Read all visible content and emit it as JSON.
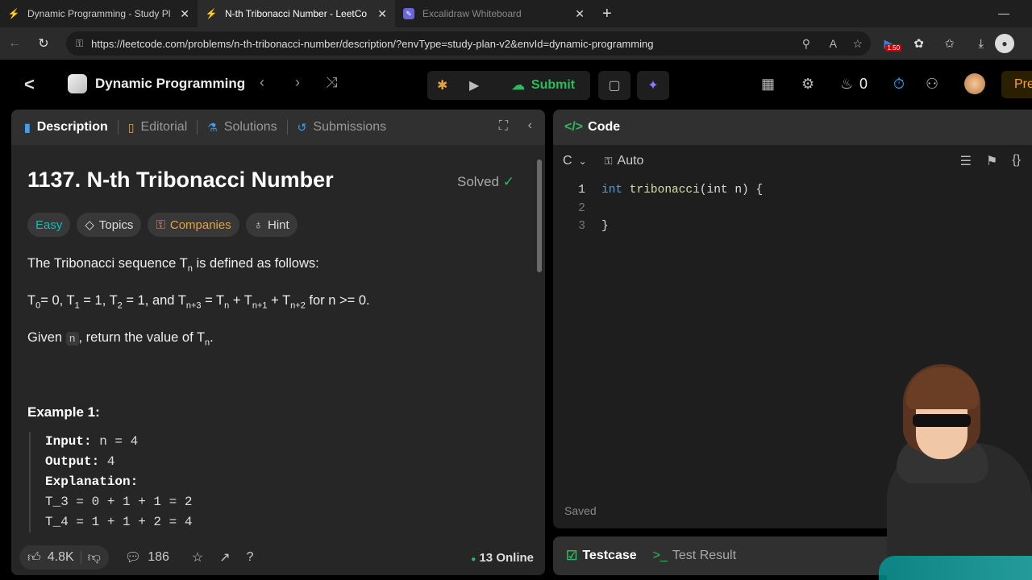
{
  "browser": {
    "tabs": [
      {
        "title": "Dynamic Programming - Study Pl",
        "active": false
      },
      {
        "title": "N-th Tribonacci Number - LeetCo",
        "active": true
      },
      {
        "title": "Excalidraw Whiteboard",
        "active": false
      }
    ],
    "url": "https://leetcode.com/problems/n-th-tribonacci-number/description/?envType=study-plan-v2&envId=dynamic-programming",
    "ext_badge": "1.50"
  },
  "nav": {
    "study_plan": "Dynamic Programming",
    "submit_label": "Submit",
    "streak": "0",
    "premium_label": "Pre"
  },
  "left": {
    "tabs": [
      {
        "label": "Description",
        "icon": "doc-icon"
      },
      {
        "label": "Editorial",
        "icon": "book-icon"
      },
      {
        "label": "Solutions",
        "icon": "flask-icon"
      },
      {
        "label": "Submissions",
        "icon": "history-icon"
      }
    ],
    "title": "1137. N-th Tribonacci Number",
    "status": "Solved",
    "chips": {
      "difficulty": "Easy",
      "topics": "Topics",
      "companies": "Companies",
      "hint": "Hint"
    },
    "intro": "The Tribonacci sequence T",
    "intro_sub": "n",
    "intro_end": " is defined as follows:",
    "def": {
      "t0": "T",
      "t0s": "0",
      "t0v": "= 0, ",
      "t1": "T",
      "t1s": "1",
      "t1v": " = 1, ",
      "t2": "T",
      "t2s": "2",
      "t2v": " = 1, and ",
      "t3": "T",
      "t3s": "n+3",
      "t3v": " = ",
      "t4": "T",
      "t4s": "n",
      "t4v": " + ",
      "t5": "T",
      "t5s": "n+1",
      "t5v": " + ",
      "t6": "T",
      "t6s": "n+2",
      "t6v": " for n >= 0."
    },
    "given_pre": "Given ",
    "given_code": "n",
    "given_post": ", return the value of T",
    "given_sub": "n",
    "given_end": ".",
    "example_heading": "Example 1:",
    "example": {
      "input_label": "Input:",
      "input_val": " n = 4",
      "output_label": "Output:",
      "output_val": " 4",
      "expl_label": "Explanation:",
      "lines": [
        "T_3 = 0 + 1 + 1 = 2",
        "T_4 = 1 + 1 + 2 = 4"
      ]
    },
    "footer": {
      "likes": "4.8K",
      "comments": "186",
      "online": "13 Online"
    }
  },
  "right": {
    "header": "Code",
    "language": "C",
    "mode": "Auto",
    "code_lines": [
      {
        "n": "1",
        "kw": "int",
        "fn": " tribonacci",
        "rest": "(int n) {"
      },
      {
        "n": "2",
        "kw": "",
        "fn": "",
        "rest": ""
      },
      {
        "n": "3",
        "kw": "",
        "fn": "",
        "rest": "}"
      }
    ],
    "saved": "Saved",
    "footer_tabs": [
      "Testcase",
      "Test Result"
    ]
  }
}
